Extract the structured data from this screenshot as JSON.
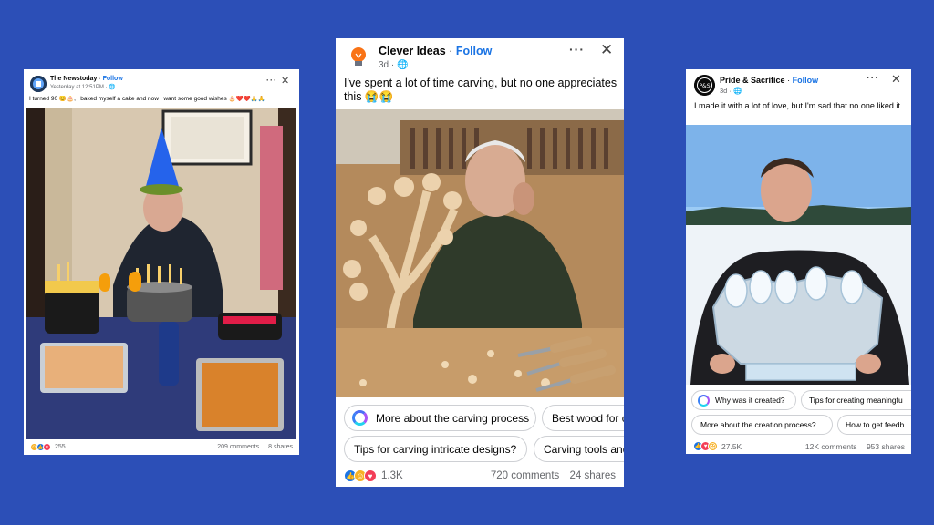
{
  "colors": {
    "background": "#2c4fb7",
    "follow": "#1b74e4"
  },
  "posts": [
    {
      "page_name": "The Newstoday",
      "follow_label": "Follow",
      "timestamp": "Yesterday at 12:51PM",
      "caption": "I turned 90 😊🎂, I baked myself a cake and now I want some good wishes 🎂❤️❤️🙏🙏",
      "reaction_count": "255",
      "comments": "209 comments",
      "shares": "8 shares",
      "avatar_icon": "newspaper-logo-icon",
      "photo_subject": "elderly man with party hat and birthday cakes"
    },
    {
      "page_name": "Clever Ideas",
      "follow_label": "Follow",
      "timestamp": "3d",
      "caption": "I've spent a lot of time carving, but no one appreciates this 😭😭",
      "reaction_count": "1.3K",
      "comments": "720 comments",
      "shares": "24 shares",
      "avatar_icon": "lightbulb-icon",
      "photo_subject": "crying old man with wooden bell-tree carving",
      "suggestions": [
        "More about the carving process",
        "Best wood for c",
        "Tips for carving intricate designs?",
        "Carving tools and"
      ]
    },
    {
      "page_name": "Pride & Sacrifice",
      "follow_label": "Follow",
      "timestamp": "3d",
      "caption": "I made it with a lot of love, but I'm sad that no one liked it.",
      "reaction_count": "27.5K",
      "comments": "12K comments",
      "shares": "953 shares",
      "avatar_icon": "pride-logo-icon",
      "photo_subject": "young man holding ice sculpture of birds",
      "suggestions": [
        "Why was it created?",
        "Tips for creating meaningfu",
        "More about the creation process?",
        "How to get feedb"
      ]
    }
  ]
}
